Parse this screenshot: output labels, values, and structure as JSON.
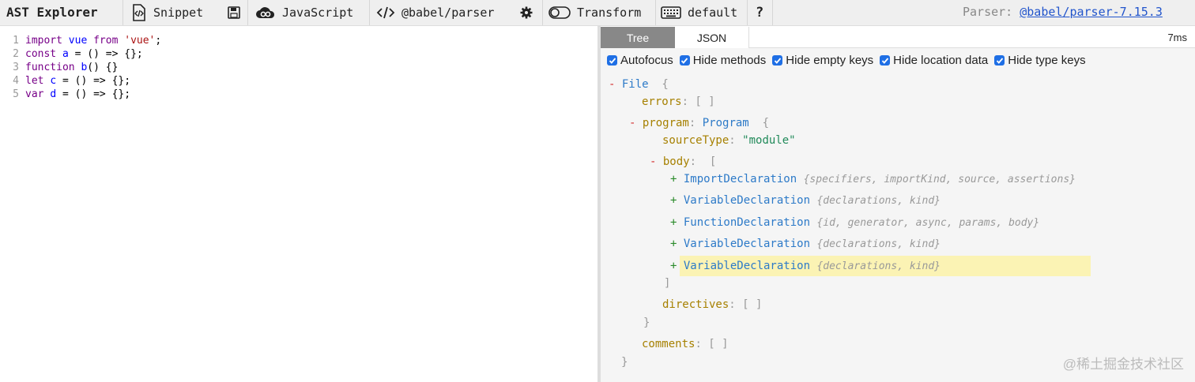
{
  "toolbar": {
    "title": "AST Explorer",
    "snippet": "Snippet",
    "language": "JavaScript",
    "parser": "@babel/parser",
    "transform": "Transform",
    "keymap": "default",
    "help": "?",
    "parser_label": "Parser:",
    "parser_version": "@babel/parser-7.15.3"
  },
  "editor": {
    "lines": [
      {
        "num": "1",
        "parts": [
          {
            "t": "import",
            "c": "kw"
          },
          {
            "t": " vue ",
            "c": "def"
          },
          {
            "t": "from",
            "c": "kw"
          },
          {
            "t": " ",
            "c": "plain"
          },
          {
            "t": "'vue'",
            "c": "str"
          },
          {
            "t": ";",
            "c": "plain"
          }
        ]
      },
      {
        "num": "2",
        "parts": [
          {
            "t": "const",
            "c": "kw"
          },
          {
            "t": " ",
            "c": "plain"
          },
          {
            "t": "a",
            "c": "def"
          },
          {
            "t": " = () => {};",
            "c": "plain"
          }
        ]
      },
      {
        "num": "3",
        "parts": [
          {
            "t": "function",
            "c": "kw"
          },
          {
            "t": " ",
            "c": "plain"
          },
          {
            "t": "b",
            "c": "def"
          },
          {
            "t": "() {}",
            "c": "plain"
          }
        ]
      },
      {
        "num": "4",
        "parts": [
          {
            "t": "let",
            "c": "kw"
          },
          {
            "t": " ",
            "c": "plain"
          },
          {
            "t": "c",
            "c": "def"
          },
          {
            "t": " = () => {};",
            "c": "plain"
          }
        ]
      },
      {
        "num": "5",
        "parts": [
          {
            "t": "var",
            "c": "kw"
          },
          {
            "t": " ",
            "c": "plain"
          },
          {
            "t": "d",
            "c": "def"
          },
          {
            "t": " = () => {};",
            "c": "plain"
          }
        ]
      }
    ]
  },
  "panel": {
    "tabs": [
      "Tree",
      "JSON"
    ],
    "time": "7ms",
    "options": [
      "Autofocus",
      "Hide methods",
      "Hide empty keys",
      "Hide location data",
      "Hide type keys"
    ],
    "tree": {
      "file": "File",
      "errors_key": "errors",
      "program_key": "program",
      "program_type": "Program",
      "sourceType_key": "sourceType",
      "sourceType_value": "\"module\"",
      "body_key": "body",
      "body_items": [
        {
          "type": "ImportDeclaration",
          "summary": "{specifiers, importKind, source, assertions}"
        },
        {
          "type": "VariableDeclaration",
          "summary": "{declarations, kind}"
        },
        {
          "type": "FunctionDeclaration",
          "summary": "{id, generator, async, params, body}"
        },
        {
          "type": "VariableDeclaration",
          "summary": "{declarations, kind}"
        },
        {
          "type": "VariableDeclaration",
          "summary": "{declarations, kind}"
        }
      ],
      "directives_key": "directives",
      "comments_key": "comments"
    }
  },
  "watermark": "@稀土掘金技术社区"
}
